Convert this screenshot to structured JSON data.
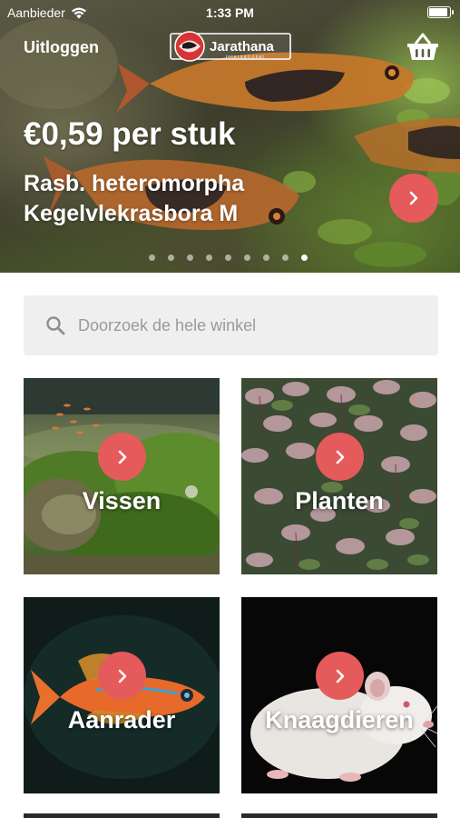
{
  "status_bar": {
    "carrier": "Aanbieder",
    "time": "1:33 PM"
  },
  "nav": {
    "logout_label": "Uitloggen",
    "logo_text": "Jarathana",
    "logo_subtext": "international",
    "basket_icon": "basket-icon"
  },
  "promo": {
    "price": "€0,59 per stuk",
    "name_line1": "Rasb. heteromorpha",
    "name_line2": "Kegelvlekrasbora M"
  },
  "carousel": {
    "total_slides": 9,
    "active_index": 8
  },
  "search": {
    "placeholder": "Doorzoek de hele winkel",
    "value": ""
  },
  "categories": [
    {
      "label": "Vissen"
    },
    {
      "label": "Planten"
    },
    {
      "label": "Aanrader"
    },
    {
      "label": "Knaagdieren"
    }
  ],
  "colors": {
    "accent": "#e55a5a",
    "search_bg": "#efefef"
  }
}
